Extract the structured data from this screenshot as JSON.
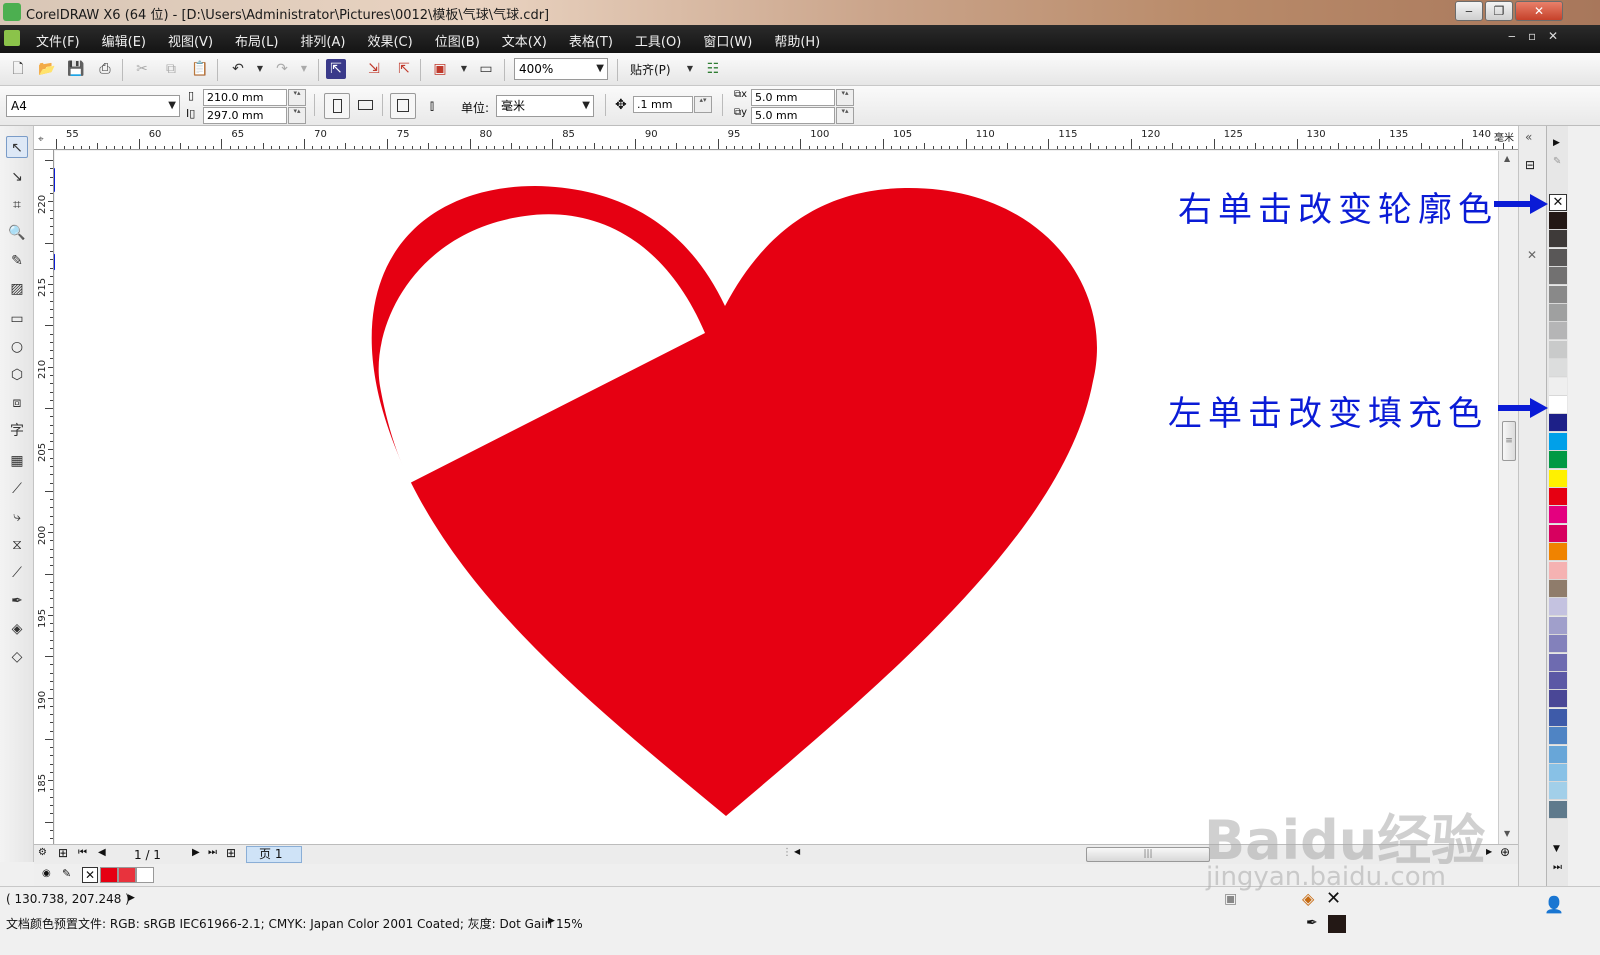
{
  "window": {
    "title": "CorelDRAW X6 (64 位) - [D:\\Users\\Administrator\\Pictures\\0012\\模板\\气球\\气球.cdr]",
    "minimize": "‒",
    "restore": "❐",
    "close": "✕"
  },
  "menu": [
    "文件(F)",
    "编辑(E)",
    "视图(V)",
    "布局(L)",
    "排列(A)",
    "效果(C)",
    "位图(B)",
    "文本(X)",
    "表格(T)",
    "工具(O)",
    "窗口(W)",
    "帮助(H)"
  ],
  "toolbar": {
    "zoom": "400%",
    "snap": "贴齐(P)"
  },
  "property_bar": {
    "page_size": "A4",
    "width": "210.0 mm",
    "height": "297.0 mm",
    "units_label": "单位:",
    "units": "毫米",
    "nudge": ".1 mm",
    "dup_x": "5.0 mm",
    "dup_y": "5.0 mm"
  },
  "ruler": {
    "h_labels": [
      "55",
      "60",
      "65",
      "70",
      "75",
      "80",
      "85",
      "90",
      "95",
      "100",
      "105",
      "110",
      "115",
      "120",
      "125",
      "130",
      "135",
      "140"
    ],
    "h_unit": "毫米",
    "v_labels": [
      "220",
      "215",
      "210",
      "205",
      "200",
      "195",
      "190",
      "185"
    ]
  },
  "page_nav": {
    "counter": "1 / 1",
    "tab": "页 1"
  },
  "annotations": {
    "outline": "右单击改变轮廓色",
    "fill": "左单击改变填充色"
  },
  "colors": {
    "heart": "#e60012",
    "annotation": "#0a1bd6",
    "palette": [
      "#231815",
      "#3e3a39",
      "#595757",
      "#727171",
      "#898989",
      "#9fa0a0",
      "#b5b5b6",
      "#c9caca",
      "#dcdddd",
      "#efefef",
      "#ffffff",
      "#1d2088",
      "#00a0e9",
      "#009944",
      "#fff100",
      "#e60012",
      "#e4007f",
      "#d7005f",
      "#f08300",
      "#f5b2b2",
      "#8f7c6b",
      "#c4c2e0",
      "#a09fcb",
      "#8381bb",
      "#6e6bb0",
      "#5b58a5",
      "#4a4796",
      "#3e5ba9",
      "#4f84c4",
      "#68a6d8",
      "#88c1e6",
      "#a2cfe9",
      "#5f7a8c"
    ]
  },
  "swatches": [
    "#e60012",
    "#e8333d",
    "#ffffff"
  ],
  "status": {
    "coords": "( 130.738, 207.248 )",
    "color_profile": "文档颜色预置文件: RGB: sRGB IEC61966-2.1; CMYK: Japan Color 2001 Coated; 灰度: Dot Gain 15%"
  },
  "watermark": {
    "brand": "Baidu经验",
    "url": "jingyan.baidu.com"
  }
}
